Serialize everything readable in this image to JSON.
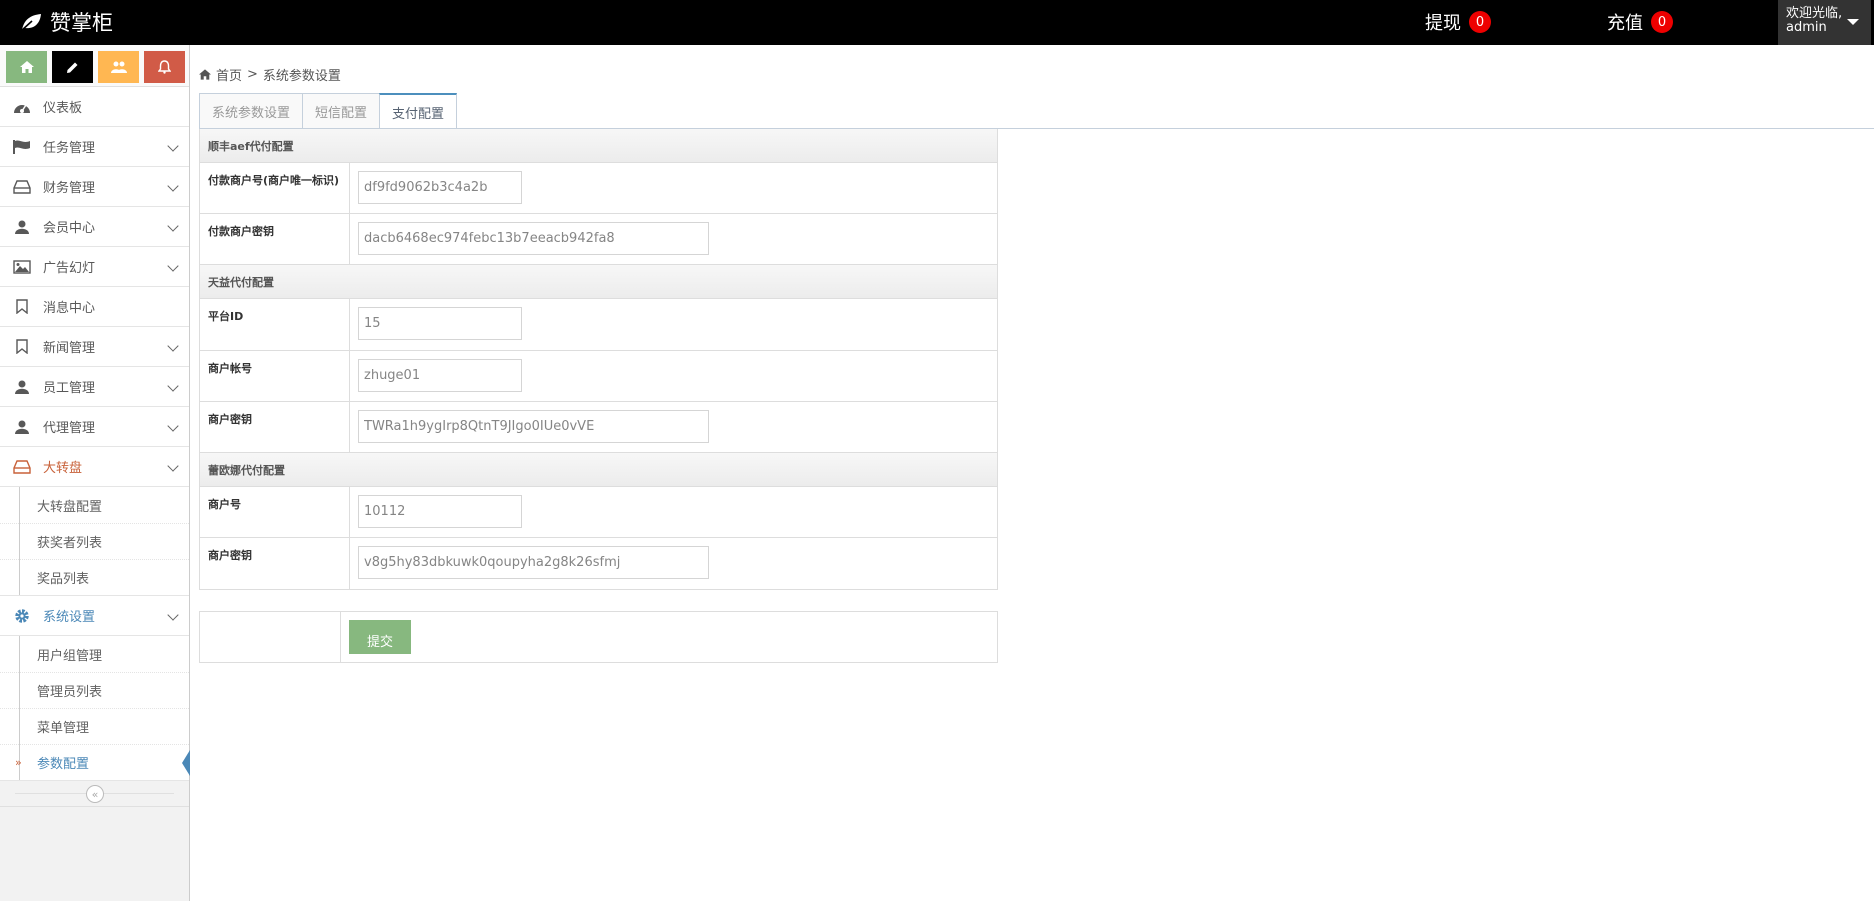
{
  "navbar": {
    "brand": "赞掌柜",
    "withdraw_label": "提现",
    "withdraw_count": "0",
    "recharge_label": "充值",
    "recharge_count": "0",
    "welcome": "欢迎光临,",
    "username": "admin"
  },
  "shortcuts": [
    {
      "icon": "home-icon",
      "color": "#87b87f"
    },
    {
      "icon": "pencil-icon",
      "color": "#000000"
    },
    {
      "icon": "users-icon",
      "color": "#ffb752"
    },
    {
      "icon": "bell-icon",
      "color": "#d15b47"
    }
  ],
  "sidebar": {
    "items": [
      {
        "label": "仪表板",
        "icon": "dashboard-icon"
      },
      {
        "label": "任务管理",
        "icon": "flag-icon"
      },
      {
        "label": "财务管理",
        "icon": "drive-icon"
      },
      {
        "label": "会员中心",
        "icon": "user-icon"
      },
      {
        "label": "广告幻灯",
        "icon": "picture-icon"
      },
      {
        "label": "消息中心",
        "icon": "bookmark-icon"
      },
      {
        "label": "新闻管理",
        "icon": "bookmark-icon"
      },
      {
        "label": "员工管理",
        "icon": "user-icon"
      },
      {
        "label": "代理管理",
        "icon": "user-icon"
      },
      {
        "label": "大转盘",
        "icon": "drive-icon"
      },
      {
        "label": "系统设置",
        "icon": "gear-icon"
      }
    ],
    "wheel_sub": [
      "大转盘配置",
      "获奖者列表",
      "奖品列表"
    ],
    "system_sub": [
      "用户组管理",
      "管理员列表",
      "菜单管理",
      "参数配置"
    ],
    "collapse_glyph": "«"
  },
  "breadcrumb": {
    "home": "首页",
    "separator": ">",
    "current": "系统参数设置"
  },
  "tabs": [
    "系统参数设置",
    "短信配置",
    "支付配置"
  ],
  "form": {
    "g1": {
      "title": "顺丰aef代付配置",
      "merchant_id_label": "付款商户号(商户唯一标识)",
      "merchant_id_value": "df9fd9062b3c4a2b",
      "merchant_key_label": "付款商户密钥",
      "merchant_key_value": "dacb6468ec974febc13b7eeacb942fa8"
    },
    "g2": {
      "title": "天益代付配置",
      "platform_id_label": "平台ID",
      "platform_id_value": "15",
      "account_label": "商户帐号",
      "account_value": "zhuge01",
      "key_label": "商户密钥",
      "key_value": "TWRa1h9ygIrp8QtnT9JIgo0IUe0vVE"
    },
    "g3": {
      "title": "蕾欧娜代付配置",
      "merchant_no_label": "商户号",
      "merchant_no_value": "10112",
      "key_label": "商户密钥",
      "key_value": "v8g5hy83dbkuwk0qoupyha2g8k26sfmj"
    },
    "submit_label": "提交"
  }
}
